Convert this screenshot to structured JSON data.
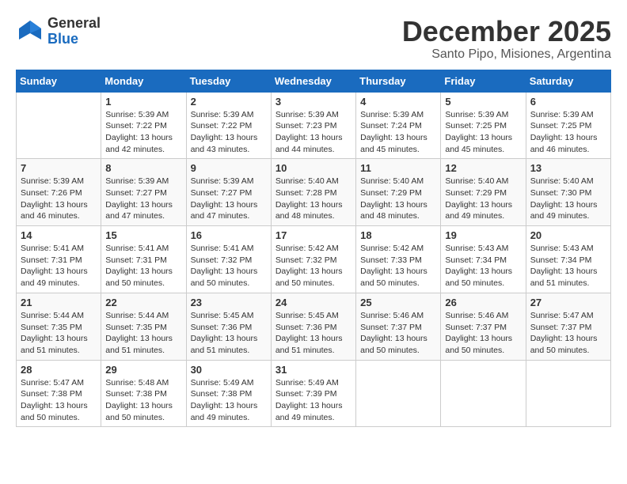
{
  "header": {
    "logo": {
      "general": "General",
      "blue": "Blue"
    },
    "title": "December 2025",
    "location": "Santo Pipo, Misiones, Argentina"
  },
  "calendar": {
    "days_of_week": [
      "Sunday",
      "Monday",
      "Tuesday",
      "Wednesday",
      "Thursday",
      "Friday",
      "Saturday"
    ],
    "weeks": [
      [
        {
          "day": "",
          "info": ""
        },
        {
          "day": "1",
          "info": "Sunrise: 5:39 AM\nSunset: 7:22 PM\nDaylight: 13 hours\nand 42 minutes."
        },
        {
          "day": "2",
          "info": "Sunrise: 5:39 AM\nSunset: 7:22 PM\nDaylight: 13 hours\nand 43 minutes."
        },
        {
          "day": "3",
          "info": "Sunrise: 5:39 AM\nSunset: 7:23 PM\nDaylight: 13 hours\nand 44 minutes."
        },
        {
          "day": "4",
          "info": "Sunrise: 5:39 AM\nSunset: 7:24 PM\nDaylight: 13 hours\nand 45 minutes."
        },
        {
          "day": "5",
          "info": "Sunrise: 5:39 AM\nSunset: 7:25 PM\nDaylight: 13 hours\nand 45 minutes."
        },
        {
          "day": "6",
          "info": "Sunrise: 5:39 AM\nSunset: 7:25 PM\nDaylight: 13 hours\nand 46 minutes."
        }
      ],
      [
        {
          "day": "7",
          "info": "Sunrise: 5:39 AM\nSunset: 7:26 PM\nDaylight: 13 hours\nand 46 minutes."
        },
        {
          "day": "8",
          "info": "Sunrise: 5:39 AM\nSunset: 7:27 PM\nDaylight: 13 hours\nand 47 minutes."
        },
        {
          "day": "9",
          "info": "Sunrise: 5:39 AM\nSunset: 7:27 PM\nDaylight: 13 hours\nand 47 minutes."
        },
        {
          "day": "10",
          "info": "Sunrise: 5:40 AM\nSunset: 7:28 PM\nDaylight: 13 hours\nand 48 minutes."
        },
        {
          "day": "11",
          "info": "Sunrise: 5:40 AM\nSunset: 7:29 PM\nDaylight: 13 hours\nand 48 minutes."
        },
        {
          "day": "12",
          "info": "Sunrise: 5:40 AM\nSunset: 7:29 PM\nDaylight: 13 hours\nand 49 minutes."
        },
        {
          "day": "13",
          "info": "Sunrise: 5:40 AM\nSunset: 7:30 PM\nDaylight: 13 hours\nand 49 minutes."
        }
      ],
      [
        {
          "day": "14",
          "info": "Sunrise: 5:41 AM\nSunset: 7:31 PM\nDaylight: 13 hours\nand 49 minutes."
        },
        {
          "day": "15",
          "info": "Sunrise: 5:41 AM\nSunset: 7:31 PM\nDaylight: 13 hours\nand 50 minutes."
        },
        {
          "day": "16",
          "info": "Sunrise: 5:41 AM\nSunset: 7:32 PM\nDaylight: 13 hours\nand 50 minutes."
        },
        {
          "day": "17",
          "info": "Sunrise: 5:42 AM\nSunset: 7:32 PM\nDaylight: 13 hours\nand 50 minutes."
        },
        {
          "day": "18",
          "info": "Sunrise: 5:42 AM\nSunset: 7:33 PM\nDaylight: 13 hours\nand 50 minutes."
        },
        {
          "day": "19",
          "info": "Sunrise: 5:43 AM\nSunset: 7:34 PM\nDaylight: 13 hours\nand 50 minutes."
        },
        {
          "day": "20",
          "info": "Sunrise: 5:43 AM\nSunset: 7:34 PM\nDaylight: 13 hours\nand 51 minutes."
        }
      ],
      [
        {
          "day": "21",
          "info": "Sunrise: 5:44 AM\nSunset: 7:35 PM\nDaylight: 13 hours\nand 51 minutes."
        },
        {
          "day": "22",
          "info": "Sunrise: 5:44 AM\nSunset: 7:35 PM\nDaylight: 13 hours\nand 51 minutes."
        },
        {
          "day": "23",
          "info": "Sunrise: 5:45 AM\nSunset: 7:36 PM\nDaylight: 13 hours\nand 51 minutes."
        },
        {
          "day": "24",
          "info": "Sunrise: 5:45 AM\nSunset: 7:36 PM\nDaylight: 13 hours\nand 51 minutes."
        },
        {
          "day": "25",
          "info": "Sunrise: 5:46 AM\nSunset: 7:37 PM\nDaylight: 13 hours\nand 50 minutes."
        },
        {
          "day": "26",
          "info": "Sunrise: 5:46 AM\nSunset: 7:37 PM\nDaylight: 13 hours\nand 50 minutes."
        },
        {
          "day": "27",
          "info": "Sunrise: 5:47 AM\nSunset: 7:37 PM\nDaylight: 13 hours\nand 50 minutes."
        }
      ],
      [
        {
          "day": "28",
          "info": "Sunrise: 5:47 AM\nSunset: 7:38 PM\nDaylight: 13 hours\nand 50 minutes."
        },
        {
          "day": "29",
          "info": "Sunrise: 5:48 AM\nSunset: 7:38 PM\nDaylight: 13 hours\nand 50 minutes."
        },
        {
          "day": "30",
          "info": "Sunrise: 5:49 AM\nSunset: 7:38 PM\nDaylight: 13 hours\nand 49 minutes."
        },
        {
          "day": "31",
          "info": "Sunrise: 5:49 AM\nSunset: 7:39 PM\nDaylight: 13 hours\nand 49 minutes."
        },
        {
          "day": "",
          "info": ""
        },
        {
          "day": "",
          "info": ""
        },
        {
          "day": "",
          "info": ""
        }
      ]
    ]
  }
}
